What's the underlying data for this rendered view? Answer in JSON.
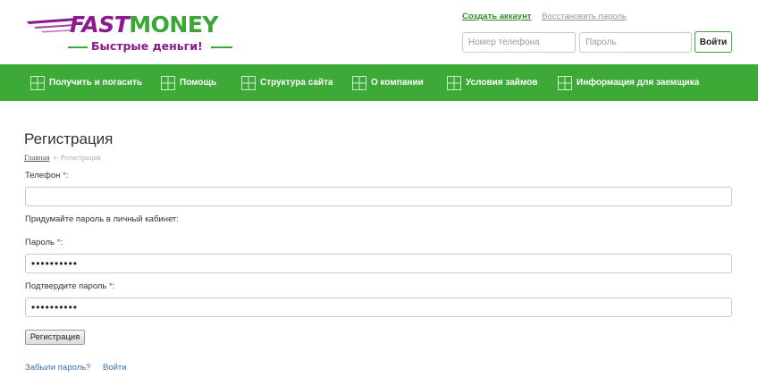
{
  "logo": {
    "fast": "FAST",
    "money": "MONEY",
    "tagline": "Быстрые деньги!"
  },
  "top_links": {
    "create_account": "Создать аккаунт",
    "restore_password": "Восстановить пароль"
  },
  "login_form": {
    "phone_placeholder": "Номер телефона",
    "password_placeholder": "Пароль",
    "submit_label": "Войти"
  },
  "nav": {
    "items": [
      {
        "label": "Получить и погасить",
        "icon": "grid-icon"
      },
      {
        "label": "Помощь",
        "icon": "grid-icon"
      },
      {
        "label": "Структура сайта",
        "icon": "grid-icon"
      },
      {
        "label": "О компании",
        "icon": "grid-icon"
      },
      {
        "label": "Условия займов",
        "icon": "grid-icon"
      },
      {
        "label": "Информация для заемщика",
        "icon": "grid-icon"
      }
    ]
  },
  "page": {
    "title": "Регистрация",
    "breadcrumb": {
      "home": "Главная",
      "separator": "»",
      "current": "Регистрация"
    }
  },
  "form": {
    "phone_label": "Телефон",
    "required_mark": "*",
    "colon": ":",
    "phone_value": "",
    "hint": "Придумайте пароль в личный кабинет:",
    "password_label": "Пароль",
    "password_value": "••••••••••",
    "confirm_label": "Подтвердите пароль",
    "confirm_value": "••••••••••",
    "submit_label": "Регистрация"
  },
  "bottom_links": {
    "forgot_password": "Забыли пароль?",
    "login": "Войти"
  },
  "colors": {
    "brand_green": "#3daa38",
    "brand_purple": "#8b1a8e",
    "link_blue": "#3b6fa8",
    "required_red": "#dd3333"
  }
}
